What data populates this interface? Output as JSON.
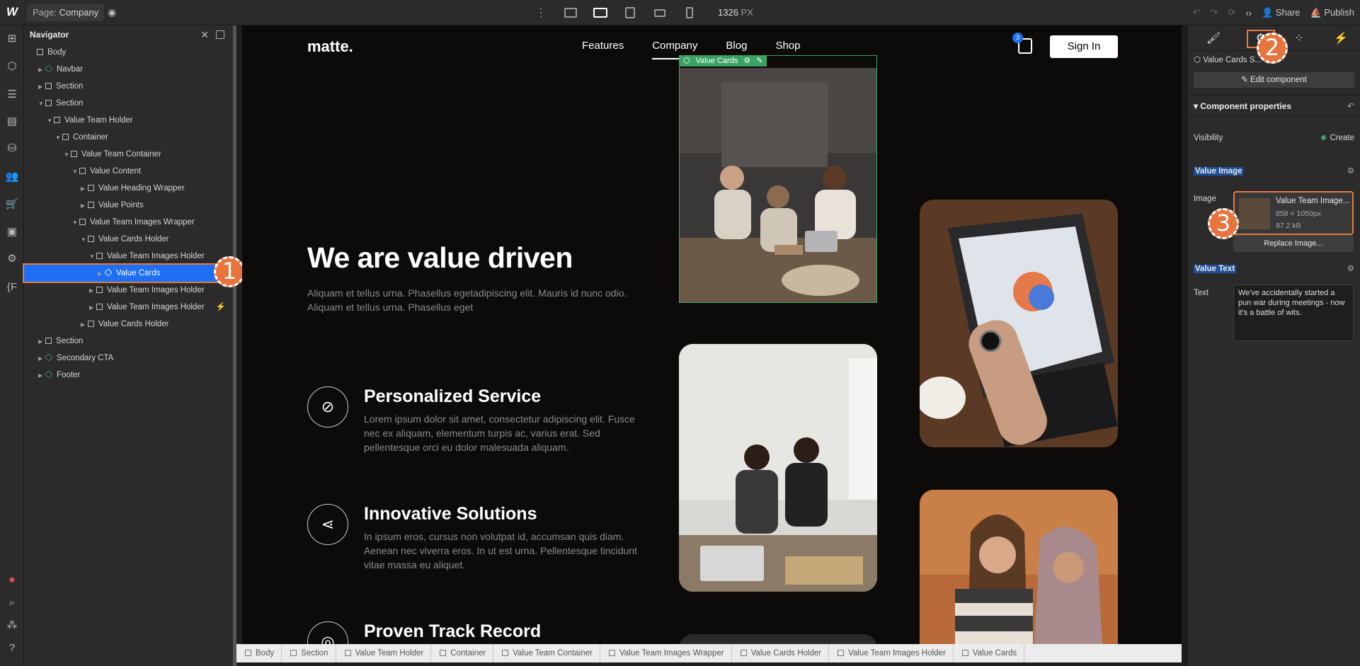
{
  "topbar": {
    "logo": "W",
    "page_prefix": "Page:",
    "page_name": "Company",
    "width_value": "1326",
    "width_unit": "PX",
    "share": "Share",
    "publish": "Publish"
  },
  "navigator": {
    "title": "Navigator",
    "items": [
      {
        "label": "Body",
        "indent": 0,
        "arrow": "",
        "icon": "box"
      },
      {
        "label": "Navbar",
        "indent": 1,
        "arrow": "▶",
        "icon": "component"
      },
      {
        "label": "Section",
        "indent": 1,
        "arrow": "▶",
        "icon": "box"
      },
      {
        "label": "Section",
        "indent": 1,
        "arrow": "▼",
        "icon": "box"
      },
      {
        "label": "Value Team Holder",
        "indent": 2,
        "arrow": "▼",
        "icon": "box"
      },
      {
        "label": "Container",
        "indent": 3,
        "arrow": "▼",
        "icon": "box"
      },
      {
        "label": "Value Team Container",
        "indent": 4,
        "arrow": "▼",
        "icon": "box"
      },
      {
        "label": "Value Content",
        "indent": 5,
        "arrow": "▼",
        "icon": "box"
      },
      {
        "label": "Value Heading Wrapper",
        "indent": 6,
        "arrow": "▶",
        "icon": "box"
      },
      {
        "label": "Value Points",
        "indent": 6,
        "arrow": "▶",
        "icon": "box"
      },
      {
        "label": "Value Team Images Wrapper",
        "indent": 5,
        "arrow": "▼",
        "icon": "box"
      },
      {
        "label": "Value Cards Holder",
        "indent": 6,
        "arrow": "▼",
        "icon": "box"
      },
      {
        "label": "Value Team Images Holder",
        "indent": 7,
        "arrow": "▼",
        "icon": "box"
      },
      {
        "label": "Value Cards",
        "indent": 8,
        "arrow": "▶",
        "icon": "component",
        "selected": true
      },
      {
        "label": "Value Team Images Holder",
        "indent": 7,
        "arrow": "▶",
        "icon": "box"
      },
      {
        "label": "Value Team Images Holder",
        "indent": 7,
        "arrow": "▶",
        "icon": "box",
        "bolt": true
      },
      {
        "label": "Value Cards Holder",
        "indent": 6,
        "arrow": "▶",
        "icon": "box"
      },
      {
        "label": "Section",
        "indent": 1,
        "arrow": "▶",
        "icon": "box"
      },
      {
        "label": "Secondary CTA",
        "indent": 1,
        "arrow": "▶",
        "icon": "component"
      },
      {
        "label": "Footer",
        "indent": 1,
        "arrow": "▶",
        "icon": "component"
      }
    ]
  },
  "badges": {
    "one": "1",
    "two": "2",
    "three": "3"
  },
  "site": {
    "logo": "matte.",
    "nav": [
      "Features",
      "Company",
      "Blog",
      "Shop"
    ],
    "active_nav": "Company",
    "cart_count": "3",
    "signin": "Sign In",
    "heading": "We are value driven",
    "intro": "Aliquam et tellus urna. Phasellus egetadipiscing elit. Mauris id nunc odio. Aliquam et tellus urna. Phasellus eget",
    "features": [
      {
        "title": "Personalized Service",
        "icon": "compass-icon",
        "desc": "Lorem ipsum dolor sit amet, consectetur adipiscing elit. Fusce nec ex aliquam, elementum turpis ac, varius erat. Sed pellentesque orci eu dolor malesuada aliquam."
      },
      {
        "title": "Innovative Solutions",
        "icon": "share-icon",
        "desc": "In ipsum eros, cursus non volutpat id, accumsan quis diam. Aenean nec viverra eros. In ut est urna. Pellentesque tincidunt vitae massa eu aliquet."
      },
      {
        "title": "Proven Track Record",
        "icon": "target-icon",
        "desc": ""
      }
    ],
    "selection_tag": "Value Cards"
  },
  "breadcrumbs": [
    "Body",
    "Section",
    "Value Team Holder",
    "Container",
    "Value Team Container",
    "Value Team Images Wrapper",
    "Value Cards Holder",
    "Value Team Images Holder",
    "Value Cards"
  ],
  "panel": {
    "component_name": "Value Cards S...",
    "edit_component": "Edit component",
    "component_properties": "Component properties",
    "visibility_label": "Visibility",
    "visibility_value": "Create",
    "value_image_heading": "Value Image",
    "image_label": "Image",
    "image_name": "Value Team Image...",
    "image_dims": "858 × 1050px",
    "image_size": "97.2 kB",
    "replace_image": "Replace Image...",
    "value_text_heading": "Value Text",
    "text_label": "Text",
    "text_value": "We've accidentally started a pun war during meetings - now it's a battle of wits."
  },
  "colors": {
    "accent": "#1e6ff5",
    "highlight": "#e27b3e",
    "component_green": "#3aa364"
  }
}
